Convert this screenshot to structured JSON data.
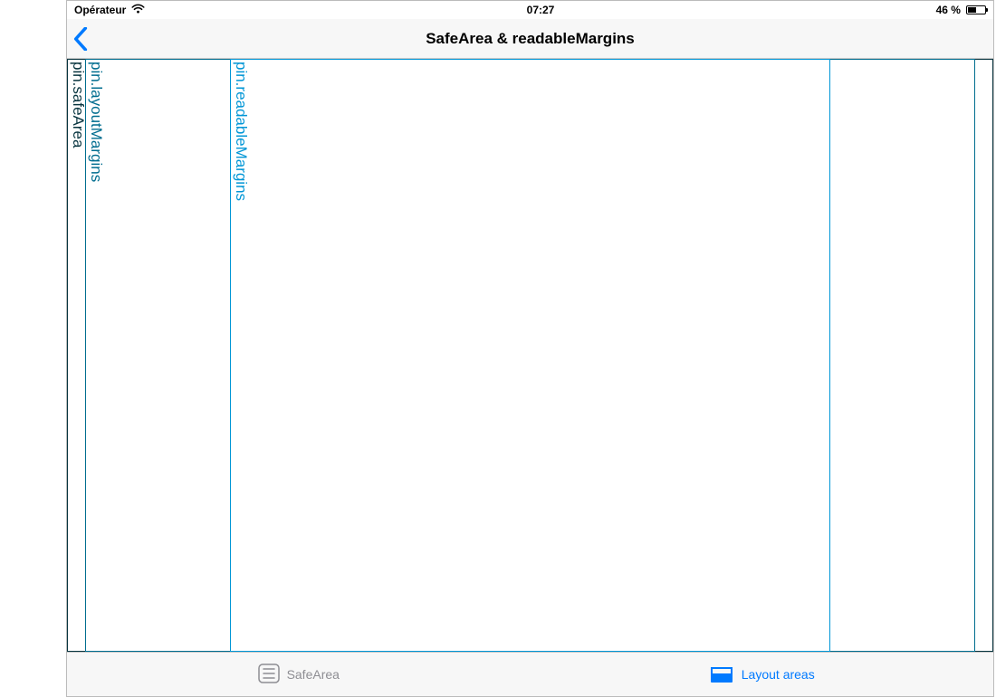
{
  "statusbar": {
    "carrier": "Opérateur",
    "time": "07:27",
    "battery_text": "46 %",
    "battery_percent": 46
  },
  "navbar": {
    "title": "SafeArea & readableMargins"
  },
  "areas": {
    "safearea_label": "pin.safeArea",
    "layoutmargins_label": "pin.layoutMargins",
    "readable_label": "pin.readableMargins"
  },
  "tabs": {
    "safearea": "SafeArea",
    "layoutareas": "Layout areas"
  },
  "colors": {
    "ios_blue": "#007aff",
    "ios_gray": "#8e8e93",
    "safearea_border": "#07343f",
    "layoutmargins_border": "#006d8f",
    "readable_border": "#0096d6"
  }
}
